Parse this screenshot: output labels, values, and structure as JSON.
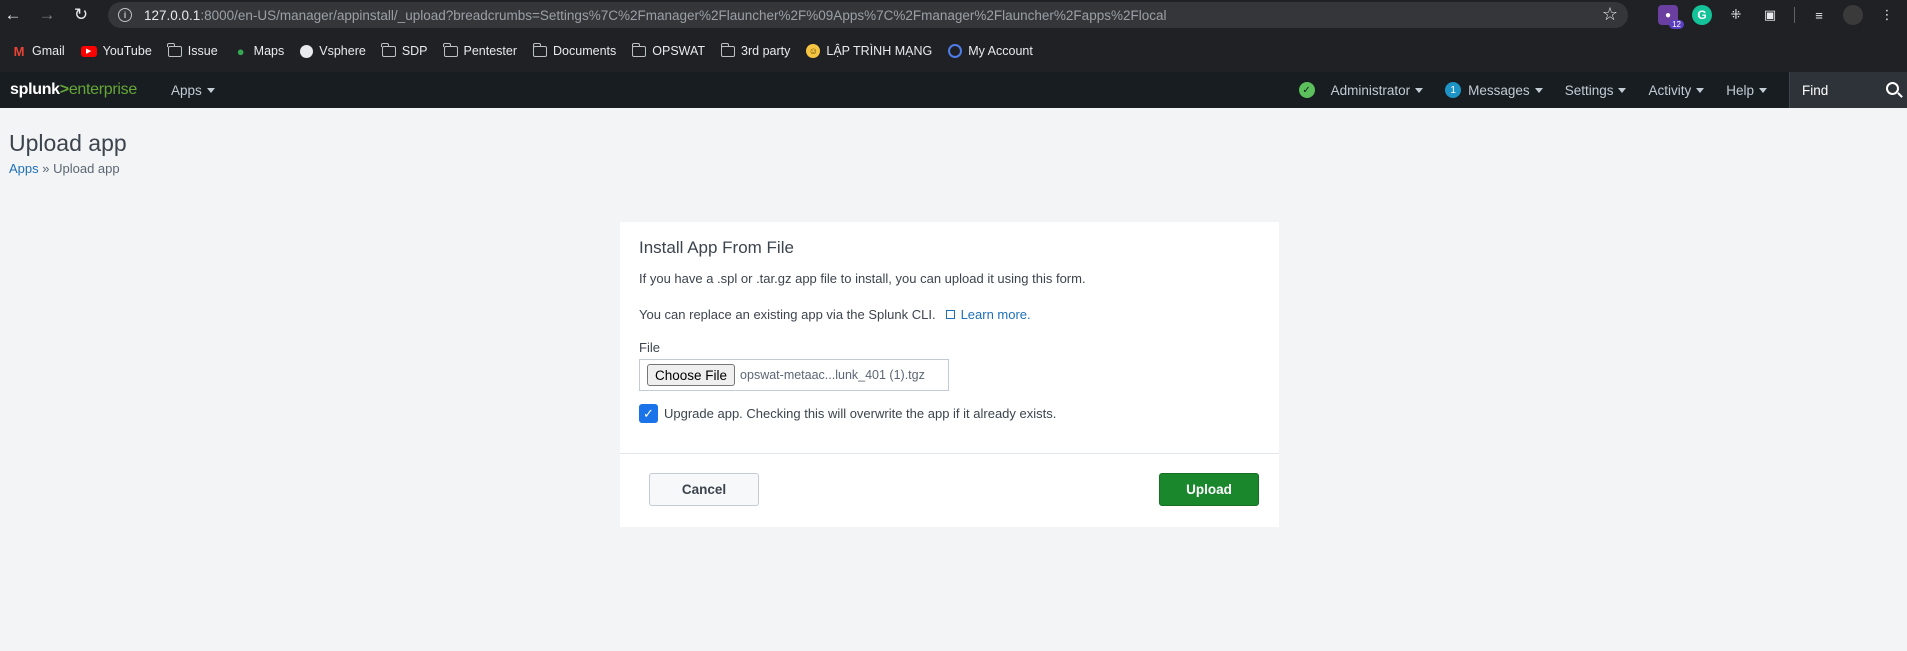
{
  "browser": {
    "url_host": "127.0.0.1",
    "url_rest": ":8000/en-US/manager/appinstall/_upload?breadcrumbs=Settings%7C%2Fmanager%2Flauncher%2F%09Apps%7C%2Fmanager%2Flauncher%2Fapps%2Flocal",
    "extension_badge": "12",
    "grammarly_label": "G",
    "bookmarks": [
      {
        "label": "Gmail",
        "icon": "gmail-icon"
      },
      {
        "label": "YouTube",
        "icon": "youtube-icon"
      },
      {
        "label": "Issue",
        "icon": "folder-icon"
      },
      {
        "label": "Maps",
        "icon": "maps-icon"
      },
      {
        "label": "Vsphere",
        "icon": "globe-icon"
      },
      {
        "label": "SDP",
        "icon": "folder-icon"
      },
      {
        "label": "Pentester",
        "icon": "folder-icon"
      },
      {
        "label": "Documents",
        "icon": "folder-icon"
      },
      {
        "label": "OPSWAT",
        "icon": "folder-icon"
      },
      {
        "label": "3rd party",
        "icon": "folder-icon"
      },
      {
        "label": "LẬP TRÌNH MẠNG",
        "icon": "smiley-icon"
      },
      {
        "label": "My Account",
        "icon": "ring-icon"
      }
    ]
  },
  "splunk": {
    "logo_main": "splunk",
    "logo_gt": ">",
    "logo_sub": "enterprise",
    "apps_label": "Apps",
    "menu": {
      "administrator": "Administrator",
      "messages_count": "1",
      "messages": "Messages",
      "settings": "Settings",
      "activity": "Activity",
      "help": "Help"
    },
    "find_placeholder": "Find"
  },
  "page": {
    "title": "Upload app",
    "breadcrumb_link": "Apps",
    "breadcrumb_sep": " » ",
    "breadcrumb_current": "Upload app"
  },
  "panel": {
    "title": "Install App From File",
    "text1": "If you have a .spl or .tar.gz app file to install, you can upload it using this form.",
    "text2": "You can replace an existing app via the Splunk CLI.",
    "learn_more": "Learn more.",
    "file_label": "File",
    "choose_file": "Choose File",
    "file_name": "opswat-metaac...lunk_401 (1).tgz",
    "upgrade_label": "Upgrade app. Checking this will overwrite the app if it already exists.",
    "upgrade_checked": true,
    "cancel": "Cancel",
    "upload": "Upload"
  },
  "colors": {
    "splunk_bar": "#171d21",
    "brand_green": "#65a637",
    "upload_green": "#1a872d",
    "link_blue": "#1e6fb7"
  }
}
